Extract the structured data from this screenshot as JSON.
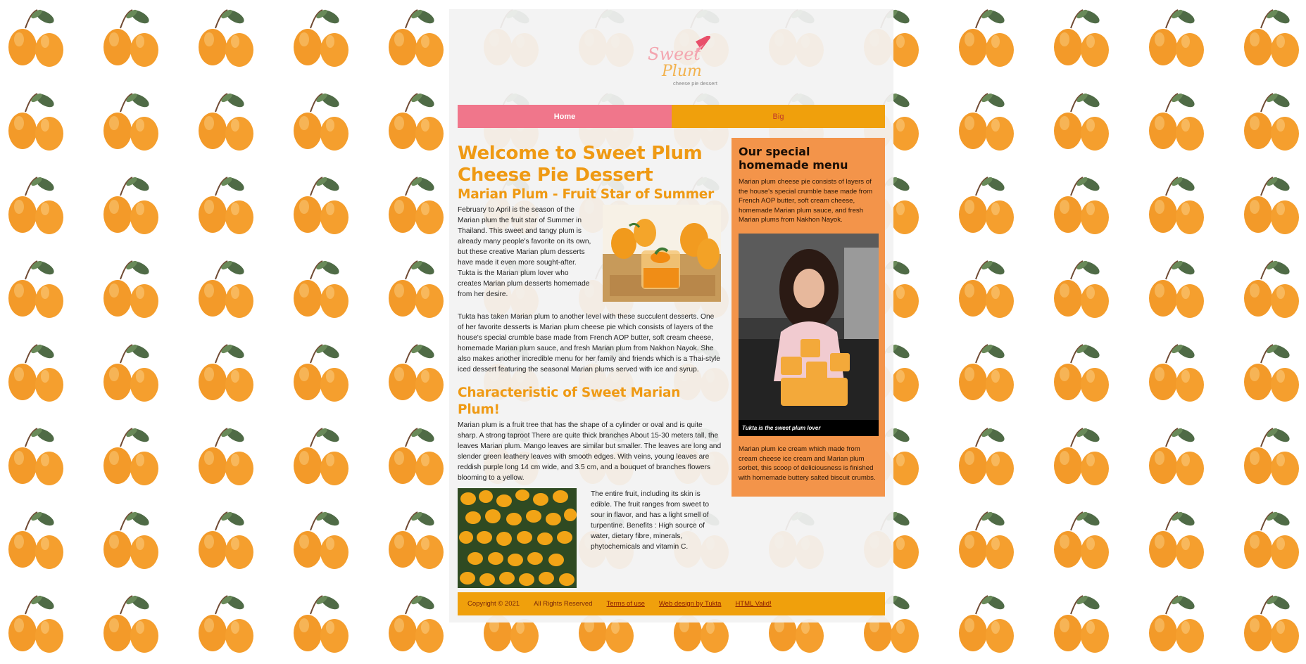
{
  "site": {
    "logo": {
      "line1": "Sweet",
      "line2": "Plum",
      "tagline": "cheese pie dessert"
    }
  },
  "nav": {
    "home": "Home",
    "big": "Big"
  },
  "main": {
    "title": "Welcome to Sweet Plum Cheese Pie Dessert",
    "section1_heading": "Marian Plum - Fruit Star of Summer",
    "p1": "February to April is the season of the Marian plum the fruit star of Summer in Thailand. This sweet and tangy plum is already many people's favorite on its own, but these creative Marian plum desserts have made it even more sought-after. Tukta is the Marian plum lover who creates Marian plum desserts homemade from her desire.",
    "p2": "Tukta has taken Marian plum to another level with these succulent desserts. One of her favorite desserts is Marian plum cheese pie which consists of layers of the house's special crumble base made from French AOP butter, soft cream cheese, homemade Marian plum sauce, and fresh Marian plum from Nakhon Nayok. She also makes another incredible menu for her family and friends which is a Thai-style iced dessert featuring the seasonal Marian plums served with ice and syrup.",
    "section2_heading": "Characteristic of Sweet Marian Plum!",
    "p3": "Marian plum is a fruit tree that has the shape of a cylinder or oval and is quite sharp. A strong taproot There are quite thick branches About 15-30 meters tall, the leaves Marian plum. Mango leaves are similar but smaller. The leaves are long and slender green leathery leaves with smooth edges. With veins, young leaves are reddish purple long 14 cm wide, and 3.5 cm, and a bouquet of branches flowers blooming to a yellow.",
    "p4": "The entire fruit, including its skin is edible. The fruit ranges from sweet to sour in flavor, and has a light smell of turpentine. Benefits : High source of water, dietary fibre, minerals, phytochemicals and vitamin C."
  },
  "aside": {
    "heading": "Our special homemade menu",
    "p1": "Marian plum cheese pie consists of layers of the house's special crumble base made from French AOP butter, soft cream cheese, homemade Marian plum sauce, and fresh Marian plums from Nakhon Nayok.",
    "photo_caption": "Tukta is the sweet plum lover",
    "p2": "Marian plum ice cream which made from cream cheese ice cream and Marian plum sorbet, this scoop of deliciousness is finished with homemade buttery salted biscuit crumbs."
  },
  "footer": {
    "copyright": "Copyright © 2021",
    "rights": "All Rights Reserved",
    "terms": "Terms of use",
    "design": "Web design by Tukta",
    "html_valid": "HTML Valid!"
  },
  "colors": {
    "nav_home": "#f0768b",
    "nav_big": "#f0a00c",
    "heading": "#ef9a14",
    "aside_bg": "#f3944a",
    "footer_bg": "#f0a00c"
  }
}
